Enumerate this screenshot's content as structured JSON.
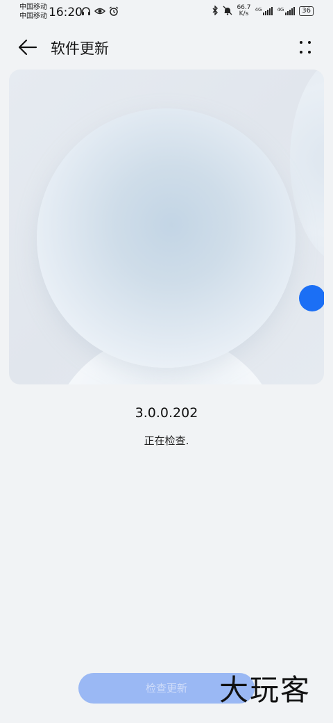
{
  "status_bar": {
    "carrier_1": "中国移动",
    "carrier_2": "中国移动",
    "time": "16:20",
    "net_speed_value": "66.7",
    "net_speed_unit": "K/s",
    "signal_tag_1": "4G",
    "signal_tag_2": "4G",
    "battery": "36",
    "icons": [
      "headphones-icon",
      "eye-icon",
      "alarm-icon",
      "bluetooth-icon",
      "mute-icon"
    ]
  },
  "header": {
    "title": "软件更新"
  },
  "update": {
    "version": "3.0.0.202",
    "status": "正在检查."
  },
  "actions": {
    "check_update_label": "检查更新"
  },
  "watermark": {
    "text": "大玩客"
  },
  "colors": {
    "accent": "#1b6ff5",
    "button_disabled": "#9ab8f4",
    "background": "#f1f3f5"
  }
}
